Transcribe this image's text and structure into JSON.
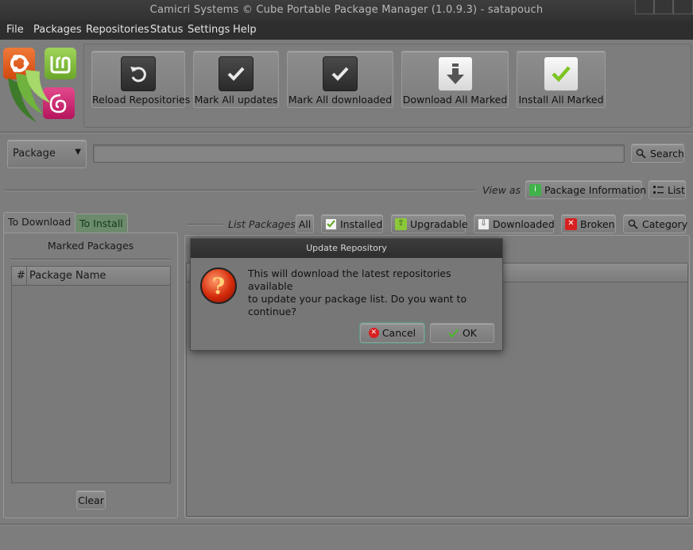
{
  "window": {
    "title": "Camicri Systems © Cube Portable Package Manager (1.0.9.3) - satapouch"
  },
  "menu": [
    "File",
    "Packages",
    "Repositories",
    "Status",
    "Settings",
    "Help"
  ],
  "toolbar": {
    "reload": "Reload Repositories",
    "mark_updates": "Mark All updates",
    "mark_downloaded": "Mark All downloaded",
    "download_marked": "Download All Marked",
    "install_marked": "Install All Marked"
  },
  "search": {
    "type_value": "Package",
    "query": "",
    "button": "Search"
  },
  "view": {
    "label": "View as",
    "package_info": "Package Information",
    "list": "List"
  },
  "tabs": {
    "to_download": "To Download",
    "to_install": "To Install"
  },
  "marked": {
    "title": "Marked Packages",
    "col_num": "#",
    "col_name": "Package Name",
    "clear": "Clear"
  },
  "filters": {
    "label": "List Packages",
    "all": "All",
    "installed": "Installed",
    "upgradable": "Upgradable",
    "downloaded": "Downloaded",
    "broken": "Broken",
    "category": "Category"
  },
  "dialog": {
    "title": "Update Repository",
    "message_line1": "This will download the latest repositories available",
    "message_line2": "to update your package list. Do you want to continue?",
    "cancel": "Cancel",
    "ok": "OK"
  }
}
